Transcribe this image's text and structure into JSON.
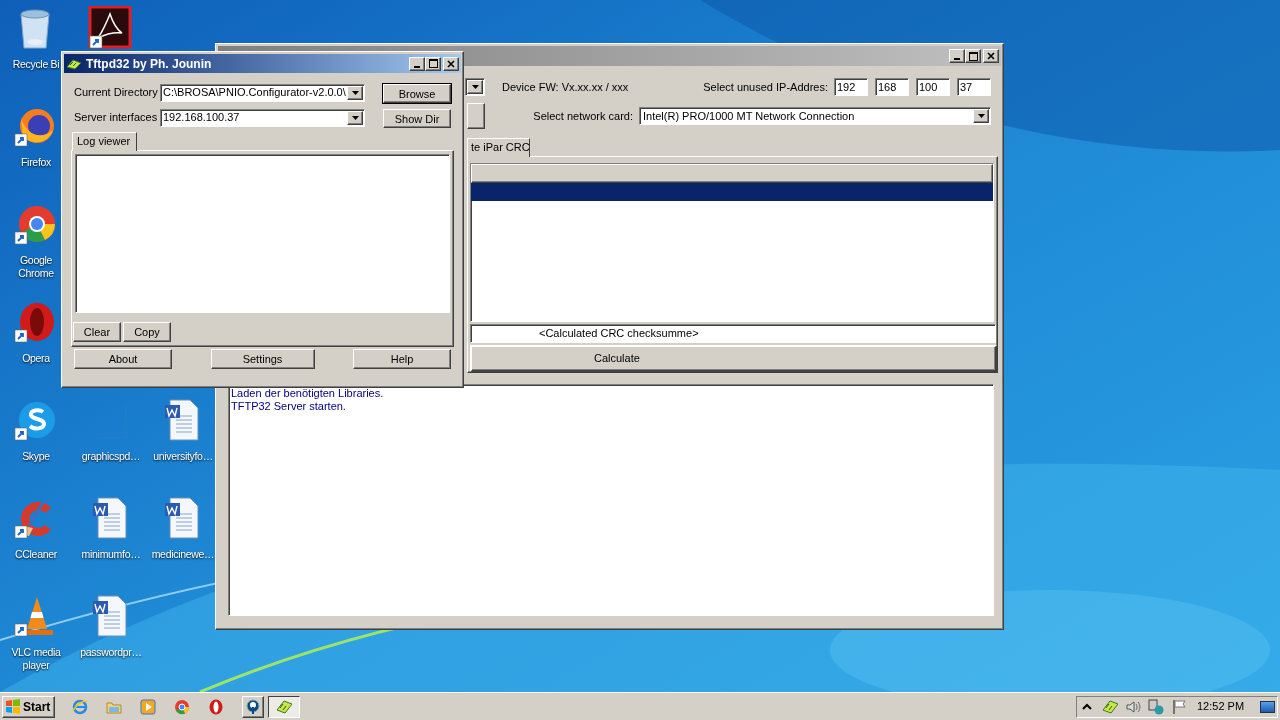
{
  "desktop_icons": [
    {
      "kind": "recycle",
      "label": "Recycle Bi"
    },
    {
      "kind": "acrobat"
    },
    {
      "kind": "firefox",
      "label": "Firefox"
    },
    {
      "kind": "chrome",
      "label": "Google Chrome"
    },
    {
      "kind": "opera",
      "label": "Opera"
    },
    {
      "kind": "skype",
      "label": "Skype"
    },
    {
      "kind": "blank",
      "label": "graphicspd…"
    },
    {
      "kind": "word",
      "label": "universityfo…"
    },
    {
      "kind": "ccleaner",
      "label": "CCleaner"
    },
    {
      "kind": "word",
      "label": "minimumfo…"
    },
    {
      "kind": "word",
      "label": "medicinewe…"
    },
    {
      "kind": "vlc",
      "label": "VLC media player"
    },
    {
      "kind": "word",
      "label": "passwordpr…"
    }
  ],
  "back_window": {
    "device_fw": "Device FW: Vx.xx.xx / xxx",
    "ip_label": "Select unused IP-Addres:",
    "ip_octets": [
      "192",
      "168",
      "100",
      "37"
    ],
    "network_label": "Select network card:",
    "network_card": "Intel(R) PRO/1000 MT Network Connection",
    "tab": {
      "label": "te iPar CRC",
      "selected": true
    },
    "list_rows": [
      {
        "selected": true
      }
    ],
    "crc_field": "<Calculated CRC checksumme>",
    "calculate_button": "Calculate",
    "log_lines": [
      "Laden der benötigten Libraries.",
      "TFTP32 Server starten."
    ]
  },
  "tftpd_window": {
    "title": "Tftpd32 by Ph. Jounin",
    "current_directory_label": "Current Directory",
    "current_directory": "C:\\BROSA\\PNIO.Configurator-v2.0.0\\",
    "server_interfaces_label": "Server interfaces",
    "server_interface": "192.168.100.37",
    "side_buttons": [
      {
        "label": "Browse",
        "default": true
      },
      {
        "label": "Show Dir",
        "default": false
      }
    ],
    "tab": {
      "label": "Log viewer",
      "selected": true
    },
    "log_buttons": [
      "Clear",
      "Copy"
    ],
    "bottom_buttons": [
      "About",
      "Settings",
      "Help"
    ]
  },
  "taskbar": {
    "start": "Start",
    "quick_launch": [
      {
        "kind": "ie"
      },
      {
        "kind": "explorer"
      },
      {
        "kind": "media"
      },
      {
        "kind": "chrome"
      },
      {
        "kind": "opera"
      }
    ],
    "windows": [
      {
        "kind": "pnio",
        "selected": false
      },
      {
        "kind": "tftpd",
        "selected": true
      }
    ],
    "tray": [
      {
        "kind": "chevron"
      },
      {
        "kind": "tftpd"
      },
      {
        "kind": "volume"
      },
      {
        "kind": "network"
      },
      {
        "kind": "flag"
      }
    ],
    "clock": "12:52 PM"
  }
}
